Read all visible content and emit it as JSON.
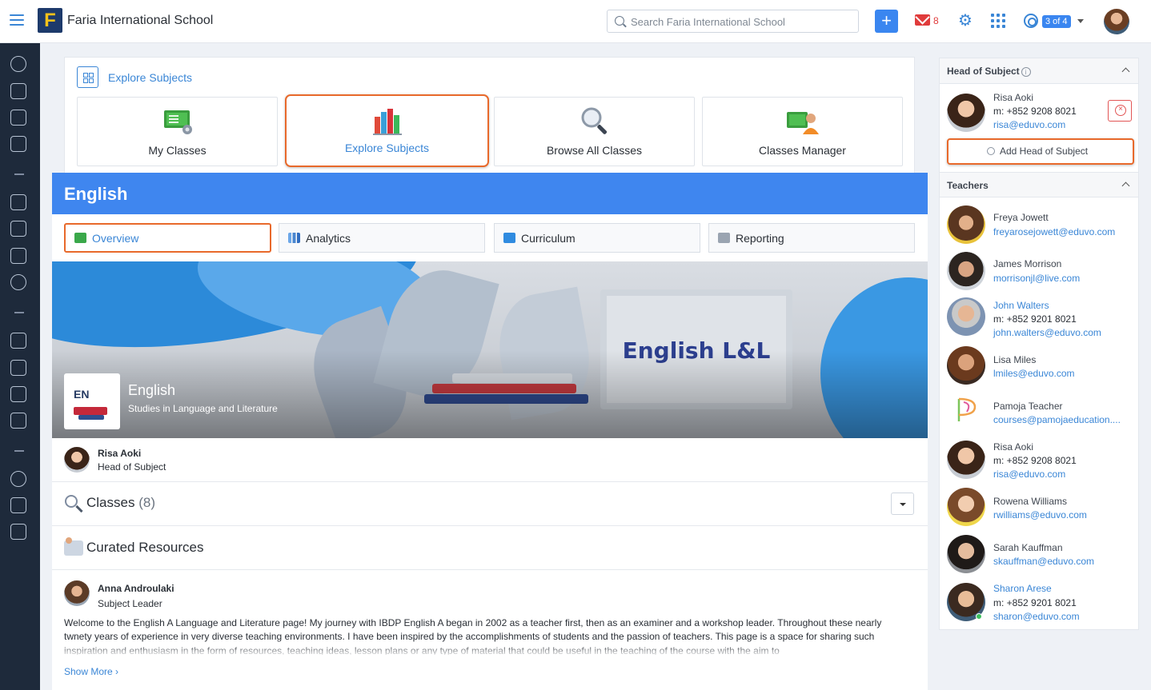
{
  "topbar": {
    "school_name": "Faria International School",
    "logo_letter": "F",
    "search_placeholder": "Search Faria International School",
    "add_label": "+",
    "mail_count": "8",
    "account_pager": "3 of 4"
  },
  "explore": {
    "header_title": "Explore Subjects",
    "tiles": [
      {
        "label": "My Classes",
        "icon": "my-classes-icon",
        "active": false
      },
      {
        "label": "Explore Subjects",
        "icon": "books-icon",
        "active": true
      },
      {
        "label": "Browse All Classes",
        "icon": "magnifier-icon",
        "active": false
      },
      {
        "label": "Classes Manager",
        "icon": "classes-manager-icon",
        "active": false
      }
    ]
  },
  "subject": {
    "title": "English",
    "tabs": [
      {
        "label": "Overview",
        "active": true
      },
      {
        "label": "Analytics",
        "active": false
      },
      {
        "label": "Curriculum",
        "active": false
      },
      {
        "label": "Reporting",
        "active": false
      }
    ],
    "hero": {
      "badge_text": "EN",
      "title": "English",
      "subtitle": "Studies in Language and Literature",
      "image_text": "English L&L"
    },
    "head_of_subject": {
      "name": "Risa Aoki",
      "role": "Head of Subject"
    },
    "classes": {
      "label": "Classes",
      "count": "(8)"
    },
    "curated": {
      "label": "Curated Resources"
    },
    "post": {
      "author": "Anna Androulaki",
      "role": "Subject Leader",
      "body": "Welcome to the English A Language and Literature page! My journey with IBDP English A began in 2002 as a teacher first, then as an examiner and a workshop leader. Throughout these nearly twnety years of experience in very diverse teaching environments. I have been inspired by the accomplishments of students and the passion of teachers. This page is a space for sharing such inspiration and enthusiasm in the form of resources, teaching ideas, lesson plans or any type of material that could be useful in the teaching of the course with the aim to",
      "show_more": "Show More"
    }
  },
  "side": {
    "hos_header": "Head of Subject",
    "hos": {
      "name": "Risa Aoki",
      "phone": "m: +852 9208 8021",
      "email": "risa@eduvo.com"
    },
    "add_hos_label": "Add Head of Subject",
    "teachers_header": "Teachers",
    "teachers": [
      {
        "name": "Freya Jowett",
        "phone": "",
        "email": "freyarosejowett@eduvo.com",
        "link": false
      },
      {
        "name": "James Morrison",
        "phone": "",
        "email": "morrisonjl@live.com",
        "link": false
      },
      {
        "name": "John Walters",
        "phone": "m: +852 9201 8021",
        "email": "john.walters@eduvo.com",
        "link": true
      },
      {
        "name": "Lisa Miles",
        "phone": "",
        "email": "lmiles@eduvo.com",
        "link": false
      },
      {
        "name": "Pamoja Teacher",
        "phone": "",
        "email": "courses@pamojaeducation....",
        "link": false
      },
      {
        "name": "Risa Aoki",
        "phone": "m: +852 9208 8021",
        "email": "risa@eduvo.com",
        "link": false
      },
      {
        "name": "Rowena Williams",
        "phone": "",
        "email": "rwilliams@eduvo.com",
        "link": false
      },
      {
        "name": "Sarah Kauffman",
        "phone": "",
        "email": "skauffman@eduvo.com",
        "link": false
      },
      {
        "name": "Sharon Arese",
        "phone": "m: +852 9201 8021",
        "email": "sharon@eduvo.com",
        "link": true
      }
    ]
  },
  "colors": {
    "accent": "#3a86d6",
    "banner": "#3f86ef",
    "highlight": "#e8692b",
    "rail": "#1e2a3b",
    "mail": "#e03b3b"
  }
}
